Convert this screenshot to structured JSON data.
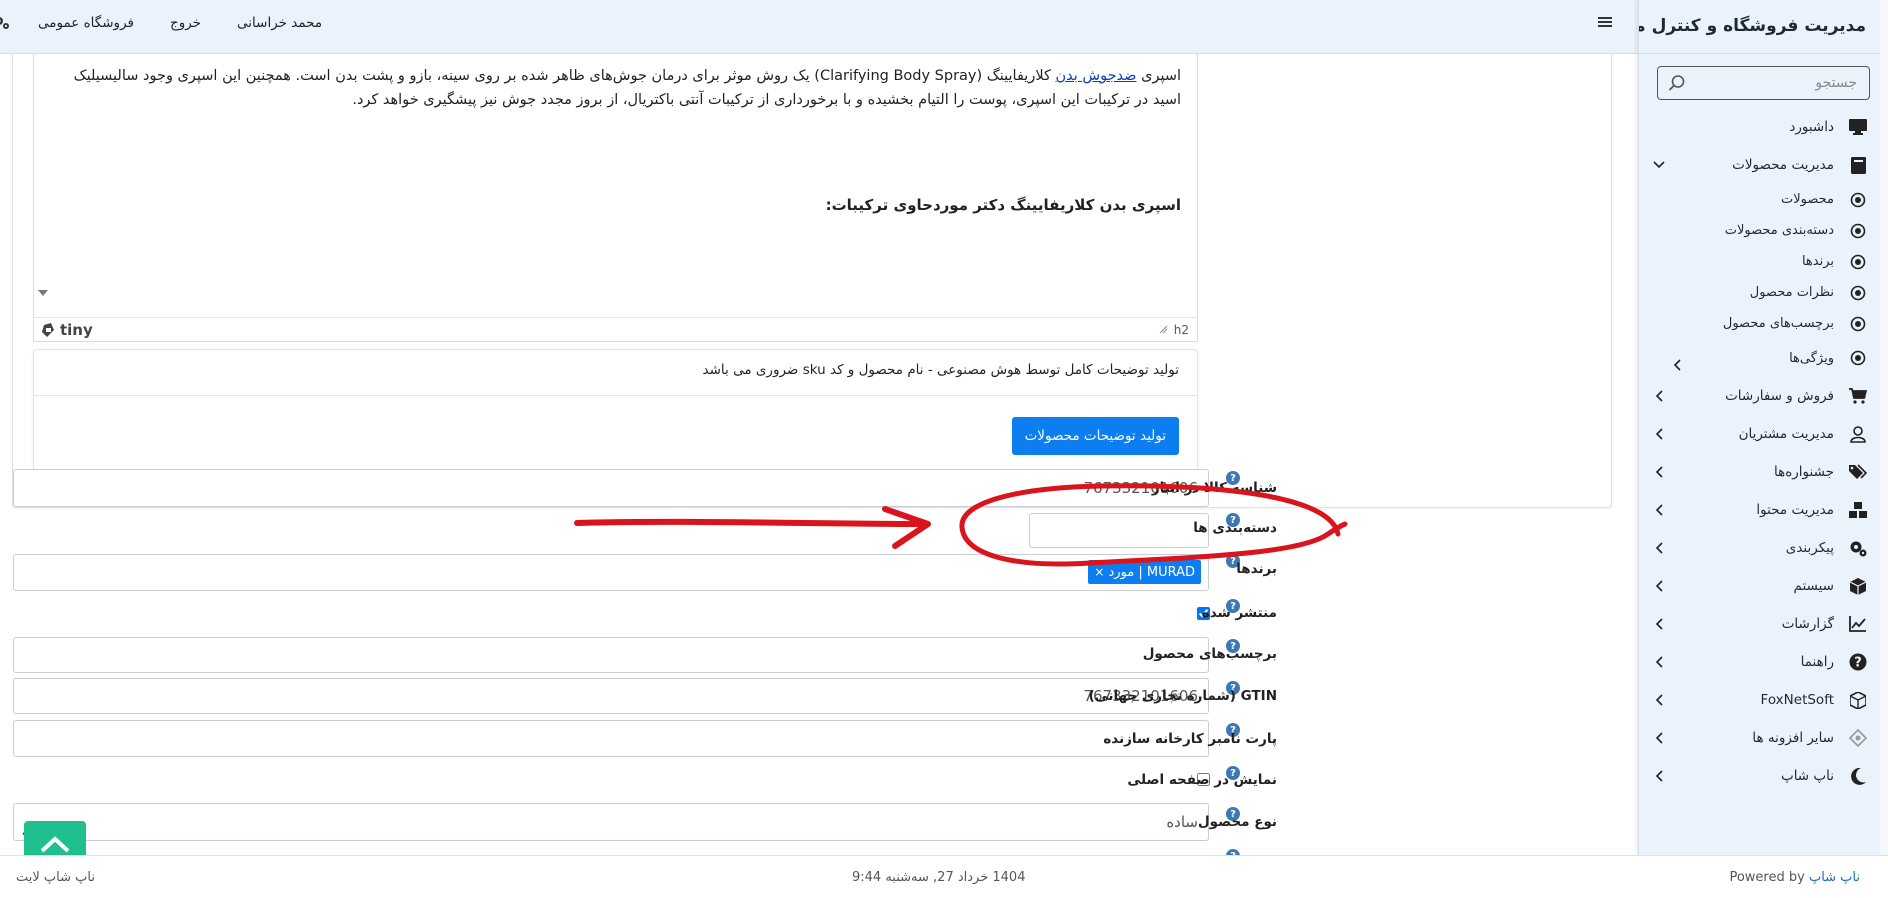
{
  "sidebar": {
    "brand": "مدیریت فروشگاه و کنترل محتوا",
    "search_placeholder": "جستجو",
    "items": [
      {
        "label": "داشبورد"
      },
      {
        "label": "مدیریت محصولات"
      },
      {
        "label": "فروش و سفارشات"
      },
      {
        "label": "مدیریت مشتریان"
      },
      {
        "label": "جشنواره‌ها"
      },
      {
        "label": "مدیریت محتوا"
      },
      {
        "label": "پیکربندی"
      },
      {
        "label": "سیستم"
      },
      {
        "label": "گزارشات"
      },
      {
        "label": "راهنما"
      },
      {
        "label": "FoxNetSoft"
      },
      {
        "label": "سایر افزونه ها"
      },
      {
        "label": "ناپ شاپ"
      }
    ],
    "subitems": [
      {
        "label": "محصولات"
      },
      {
        "label": "دسته‌بندی محصولات"
      },
      {
        "label": "برندها"
      },
      {
        "label": "نظرات محصول"
      },
      {
        "label": "برچسب‌های محصول"
      },
      {
        "label": "ویژگی‌ها"
      }
    ]
  },
  "topbar": {
    "user_name": "محمد خراسانی",
    "logout": "خروج",
    "public_store": "فروشگاه عمومی"
  },
  "editor": {
    "p1_start": "اسپری ",
    "p1_link": "ضدجوش بدن",
    "p1_rest": " کلاریفایینگ (Clarifying Body Spray) یک روش موثر برای درمان جوش‌های ظاهر شده بر روی سینه، بازو و پشت بدن است. همچنین این اسپری وجود سالیسیلیک اسید در ترکیبات این اسپری، پوست را التیام بخشیده و با برخورداری از ترکیبات آنتی باکتریال، از بروز مجدد جوش نیز پیشگیری خواهد کرد.",
    "heading": "اسپری بدن کلاریفایینگ دکتر موردحاوی ترکیبات:",
    "tiny_brand": "tiny",
    "path": "h2"
  },
  "ai": {
    "description": "تولید توضیحات کامل توسط هوش مصنوعی - نام محصول و کد sku ضروری می باشد",
    "button": "تولید توضیحات محصولات"
  },
  "form": {
    "sku_label": "شناسه کالا در انبار",
    "sku_value": "767332101606",
    "categories_label": "دسته‌بندی ها",
    "categories_value": "",
    "brands_label": "برندها",
    "brand_chip": "مورد | MURAD",
    "chip_remove": "×",
    "published_label": "منتشر شده",
    "published": true,
    "tags_label": "برچسب‌های محصول",
    "tags_value": "",
    "gtin_label": "GTIN (شماره تجاری جهانی)",
    "gtin_value": "767332101606",
    "mpn_label": "پارت نامبر کارخانه سازنده",
    "mpn_value": "",
    "homepage_label": "نمایش در صفحه اصلی",
    "homepage": false,
    "type_label": "نوع محصول",
    "type_value": "ساده",
    "help": "?"
  },
  "footer": {
    "left": "ناپ شاپ لایت",
    "center": "1404 خرداد 27, سه‌شنبه 9:44",
    "powered_prefix": "Powered by ",
    "powered_link": "ناپ شاپ"
  },
  "colors": {
    "accent": "#0d7ef0",
    "sidebar_bg": "#eaf3fc",
    "annotation_red": "#d9141d",
    "scroll_button": "#1fbf8f"
  }
}
